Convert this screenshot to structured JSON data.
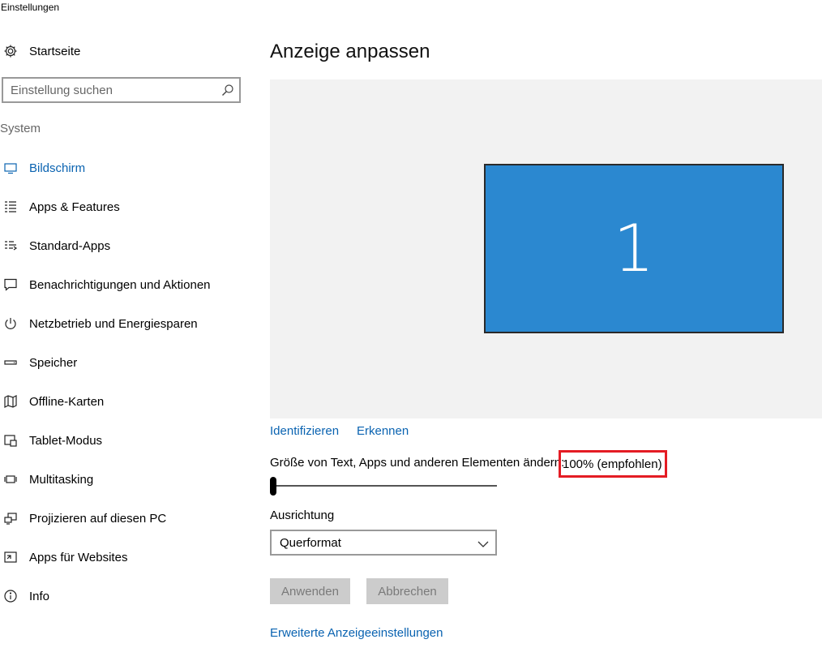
{
  "window": {
    "title": "Einstellungen"
  },
  "sidebar": {
    "home_label": "Startseite",
    "search_placeholder": "Einstellung suchen",
    "section_label": "System",
    "items": [
      {
        "label": "Bildschirm",
        "icon": "monitor-icon",
        "active": true
      },
      {
        "label": "Apps & Features",
        "icon": "list-icon"
      },
      {
        "label": "Standard-Apps",
        "icon": "default-apps-icon"
      },
      {
        "label": "Benachrichtigungen und Aktionen",
        "icon": "notification-icon"
      },
      {
        "label": "Netzbetrieb und Energiesparen",
        "icon": "power-icon"
      },
      {
        "label": "Speicher",
        "icon": "storage-icon"
      },
      {
        "label": "Offline-Karten",
        "icon": "map-icon"
      },
      {
        "label": "Tablet-Modus",
        "icon": "tablet-icon"
      },
      {
        "label": "Multitasking",
        "icon": "multitasking-icon"
      },
      {
        "label": "Projizieren auf diesen PC",
        "icon": "project-icon"
      },
      {
        "label": "Apps für Websites",
        "icon": "apps-websites-icon"
      },
      {
        "label": "Info",
        "icon": "info-icon"
      }
    ]
  },
  "main": {
    "title": "Anzeige anpassen",
    "monitor_number": "1",
    "identify_link": "Identifizieren",
    "detect_link": "Erkennen",
    "scale_label": "Größe von Text, Apps und anderen Elementen ändern:",
    "scale_value": "100% (empfohlen)",
    "scale_slider_position": 0,
    "orientation_label": "Ausrichtung",
    "orientation_value": "Querformat",
    "apply_button": "Anwenden",
    "cancel_button": "Abbrechen",
    "advanced_link": "Erweiterte Anzeigeeinstellungen"
  },
  "colors": {
    "accent": "#0a63b1",
    "monitor": "#2b88d0",
    "highlight": "#e41c24",
    "display_bg": "#f2f2f2",
    "button_bg": "#cccccc"
  }
}
